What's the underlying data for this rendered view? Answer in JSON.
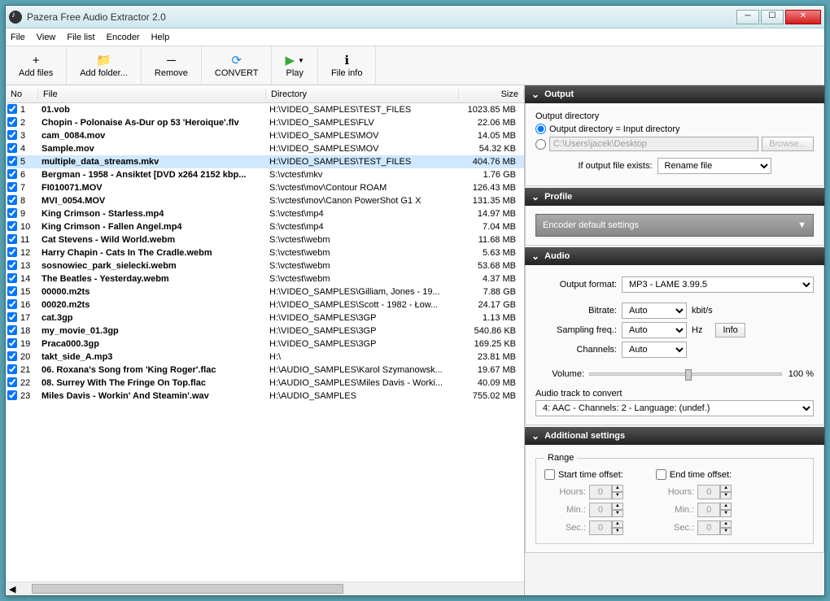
{
  "window": {
    "title": "Pazera Free Audio Extractor 2.0"
  },
  "menu": [
    "File",
    "View",
    "File list",
    "Encoder",
    "Help"
  ],
  "toolbar": {
    "add_files": "Add files",
    "add_folder": "Add folder...",
    "remove": "Remove",
    "convert": "CONVERT",
    "play": "Play",
    "file_info": "File info"
  },
  "columns": {
    "no": "No",
    "file": "File",
    "dir": "Directory",
    "size": "Size"
  },
  "files": [
    {
      "n": 1,
      "file": "01.vob",
      "dir": "H:\\VIDEO_SAMPLES\\TEST_FILES",
      "size": "1023.85 MB",
      "sel": false
    },
    {
      "n": 2,
      "file": "Chopin - Polonaise As-Dur op 53 'Heroique'.flv",
      "dir": "H:\\VIDEO_SAMPLES\\FLV",
      "size": "22.06 MB",
      "sel": false
    },
    {
      "n": 3,
      "file": "cam_0084.mov",
      "dir": "H:\\VIDEO_SAMPLES\\MOV",
      "size": "14.05 MB",
      "sel": false
    },
    {
      "n": 4,
      "file": "Sample.mov",
      "dir": "H:\\VIDEO_SAMPLES\\MOV",
      "size": "54.32 KB",
      "sel": false
    },
    {
      "n": 5,
      "file": "multiple_data_streams.mkv",
      "dir": "H:\\VIDEO_SAMPLES\\TEST_FILES",
      "size": "404.76 MB",
      "sel": true
    },
    {
      "n": 6,
      "file": "Bergman - 1958 - Ansiktet [DVD x264 2152 kbp...",
      "dir": "S:\\vctest\\mkv",
      "size": "1.76 GB",
      "sel": false
    },
    {
      "n": 7,
      "file": "FI010071.MOV",
      "dir": "S:\\vctest\\mov\\Contour ROAM",
      "size": "126.43 MB",
      "sel": false
    },
    {
      "n": 8,
      "file": "MVI_0054.MOV",
      "dir": "S:\\vctest\\mov\\Canon PowerShot G1 X",
      "size": "131.35 MB",
      "sel": false
    },
    {
      "n": 9,
      "file": "King Crimson - Starless.mp4",
      "dir": "S:\\vctest\\mp4",
      "size": "14.97 MB",
      "sel": false
    },
    {
      "n": 10,
      "file": "King Crimson - Fallen Angel.mp4",
      "dir": "S:\\vctest\\mp4",
      "size": "7.04 MB",
      "sel": false
    },
    {
      "n": 11,
      "file": "Cat Stevens - Wild World.webm",
      "dir": "S:\\vctest\\webm",
      "size": "11.68 MB",
      "sel": false
    },
    {
      "n": 12,
      "file": "Harry Chapin - Cats In The Cradle.webm",
      "dir": "S:\\vctest\\webm",
      "size": "5.63 MB",
      "sel": false
    },
    {
      "n": 13,
      "file": "sosnowiec_park_sielecki.webm",
      "dir": "S:\\vctest\\webm",
      "size": "53.68 MB",
      "sel": false
    },
    {
      "n": 14,
      "file": "The Beatles - Yesterday.webm",
      "dir": "S:\\vctest\\webm",
      "size": "4.37 MB",
      "sel": false
    },
    {
      "n": 15,
      "file": "00000.m2ts",
      "dir": "H:\\VIDEO_SAMPLES\\Gilliam, Jones - 19...",
      "size": "7.88 GB",
      "sel": false
    },
    {
      "n": 16,
      "file": "00020.m2ts",
      "dir": "H:\\VIDEO_SAMPLES\\Scott - 1982 - Łow...",
      "size": "24.17 GB",
      "sel": false
    },
    {
      "n": 17,
      "file": "cat.3gp",
      "dir": "H:\\VIDEO_SAMPLES\\3GP",
      "size": "1.13 MB",
      "sel": false
    },
    {
      "n": 18,
      "file": "my_movie_01.3gp",
      "dir": "H:\\VIDEO_SAMPLES\\3GP",
      "size": "540.86 KB",
      "sel": false
    },
    {
      "n": 19,
      "file": "Praca000.3gp",
      "dir": "H:\\VIDEO_SAMPLES\\3GP",
      "size": "169.25 KB",
      "sel": false
    },
    {
      "n": 20,
      "file": "takt_side_A.mp3",
      "dir": "H:\\",
      "size": "23.81 MB",
      "sel": false
    },
    {
      "n": 21,
      "file": "06. Roxana's Song from 'King Roger'.flac",
      "dir": "H:\\AUDIO_SAMPLES\\Karol Szymanowsk...",
      "size": "19.67 MB",
      "sel": false
    },
    {
      "n": 22,
      "file": "08. Surrey With The Fringe On Top.flac",
      "dir": "H:\\AUDIO_SAMPLES\\Miles Davis - Worki...",
      "size": "40.09 MB",
      "sel": false
    },
    {
      "n": 23,
      "file": "Miles Davis - Workin' And Steamin'.wav",
      "dir": "H:\\AUDIO_SAMPLES",
      "size": "755.02 MB",
      "sel": false
    }
  ],
  "output": {
    "title": "Output",
    "dir_label": "Output directory",
    "radio_same": "Output directory = Input directory",
    "path": "C:\\Users\\jacek\\Desktop",
    "browse": "Browse...",
    "exists_label": "If output file exists:",
    "exists_value": "Rename file"
  },
  "profile": {
    "title": "Profile",
    "value": "Encoder default settings"
  },
  "audio": {
    "title": "Audio",
    "format_label": "Output format:",
    "format_value": "MP3 - LAME 3.99.5",
    "bitrate_label": "Bitrate:",
    "bitrate_value": "Auto",
    "bitrate_unit": "kbit/s",
    "sampling_label": "Sampling freq.:",
    "sampling_value": "Auto",
    "sampling_unit": "Hz",
    "info": "Info",
    "channels_label": "Channels:",
    "channels_value": "Auto",
    "volume_label": "Volume:",
    "volume_value": "100 %",
    "track_label": "Audio track to convert",
    "track_value": "4: AAC - Channels: 2 - Language: (undef.)"
  },
  "additional": {
    "title": "Additional settings",
    "range": "Range",
    "start_offset": "Start time offset:",
    "end_offset": "End time offset:",
    "hours": "Hours:",
    "min": "Min.:",
    "sec": "Sec.:",
    "zero": "0"
  }
}
